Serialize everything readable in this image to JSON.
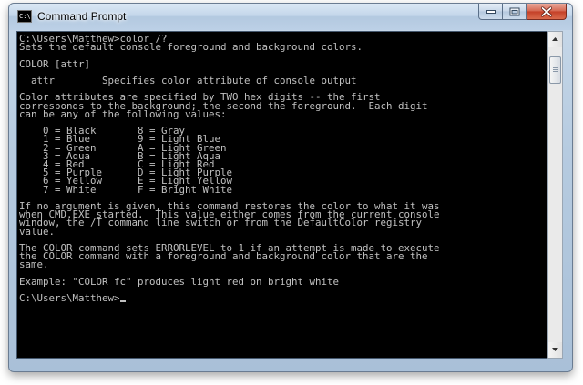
{
  "window": {
    "title": "Command Prompt",
    "icon_label": "C:\\"
  },
  "icons": {
    "app": "command-prompt-icon",
    "minimize": "minimize-icon",
    "maximize": "maximize-icon",
    "close": "close-icon",
    "scroll_up": "scroll-up-arrow-icon",
    "scroll_down": "scroll-down-arrow-icon"
  },
  "console": {
    "colors": {
      "background": "#000000",
      "foreground": "#c0c0c0"
    },
    "prompt": "C:\\Users\\Matthew>",
    "command": "color /?",
    "lines": [
      "Sets the default console foreground and background colors.",
      "",
      "COLOR [attr]",
      "",
      "  attr        Specifies color attribute of console output",
      "",
      "Color attributes are specified by TWO hex digits -- the first",
      "corresponds to the background; the second the foreground.  Each digit",
      "can be any of the following values:",
      "",
      "    0 = Black       8 = Gray",
      "    1 = Blue        9 = Light Blue",
      "    2 = Green       A = Light Green",
      "    3 = Aqua        B = Light Aqua",
      "    4 = Red         C = Light Red",
      "    5 = Purple      D = Light Purple",
      "    6 = Yellow      E = Light Yellow",
      "    7 = White       F = Bright White",
      "",
      "If no argument is given, this command restores the color to what it was",
      "when CMD.EXE started.  This value either comes from the current console",
      "window, the /T command line switch or from the DefaultColor registry",
      "value.",
      "",
      "The COLOR command sets ERRORLEVEL to 1 if an attempt is made to execute",
      "the COLOR command with a foreground and background color that are the",
      "same.",
      "",
      "Example: \"COLOR fc\" produces light red on bright white",
      ""
    ],
    "final_prompt": "C:\\Users\\Matthew>"
  }
}
